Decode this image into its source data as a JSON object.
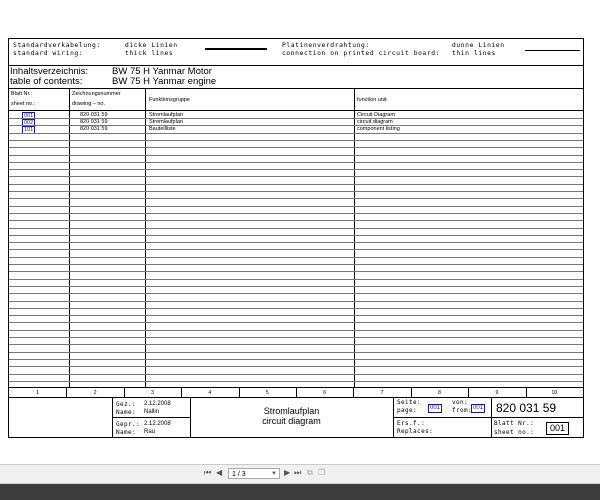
{
  "legend": {
    "standard_de": "Standardverkabelung:",
    "standard_en": "standard wiring:",
    "thick_de": "dicke Linien",
    "thick_en": "thick lines",
    "pcb_de": "Platinenverdrahtung:",
    "pcb_en": "connection on printed circuit board:",
    "thin_de": "dunne Linien",
    "thin_en": "thin lines"
  },
  "header": {
    "inhalt_label": "Inhaltsverzeichnis:",
    "inhalt_value": "BW 75 H Yanmar Motor",
    "toc_label": "table of contents:",
    "toc_value": "BW 75 H Yanmar engine"
  },
  "columns": {
    "blatt_1": "Blatt Nr.:",
    "blatt_2": "sheet no.:",
    "zeich_1": "Zeichnungsnummer",
    "zeich_2": "drawing – no.",
    "funktion": "Funktionsgruppe",
    "unit": "function unit"
  },
  "rows": [
    {
      "sheet": "001",
      "drawing": "820 031 59",
      "gruppe": "Stromlaufplan",
      "unit": "Circuit Diagram"
    },
    {
      "sheet": "002",
      "drawing": "820 031 59",
      "gruppe": "Stromlaufplan",
      "unit": "circuit diagram"
    },
    {
      "sheet": "101",
      "drawing": "820 031 59",
      "gruppe": "Bauteilliste",
      "unit": "component listing"
    }
  ],
  "column_numbers": [
    "1",
    "2",
    "3",
    "4",
    "5",
    "6",
    "7",
    "8",
    "9",
    "10"
  ],
  "titleblock": {
    "gez_label": "Gez.:",
    "gez_date": "2.12.2008",
    "name_label": "Name:",
    "name_1": "Nallin",
    "gepr_label": "Gepr.:",
    "gepr_date": "2.12.2008",
    "name_label_2": "Name:",
    "name_2": "Rau",
    "title_de": "Stromlaufplan",
    "title_en": "circuit diagram",
    "seite_label": "Seite:",
    "page_label": "page:",
    "von_label": "von:",
    "from_label": "from:",
    "page_value": "001",
    "from_value": "001",
    "drawing_no": "820 031 59",
    "ers_label": "Ers.f.:",
    "replaces_label": "Replaces:",
    "blatt_label": "Blatt Nr.:",
    "sheet_label": "sheet no.:",
    "sheet_value": "001"
  },
  "viewer": {
    "page_indicator": "1 / 3"
  }
}
